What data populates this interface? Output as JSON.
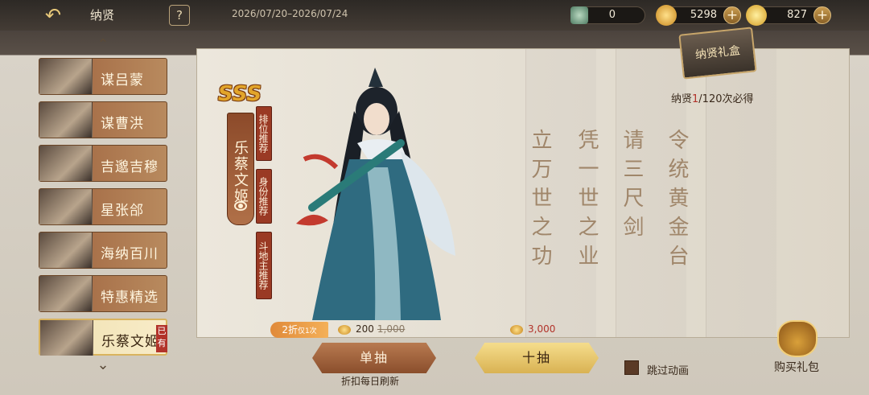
{
  "topbar": {
    "title": "纳贤",
    "help_label": "?",
    "date_range": "2026/07/20–2026/07/24",
    "resources": [
      {
        "icon": "token-icon",
        "value": "0"
      },
      {
        "icon": "gold-ingot-icon",
        "value": "5298"
      },
      {
        "icon": "treasure-ingot-icon",
        "value": "827"
      }
    ],
    "plus": "+"
  },
  "sidebar": {
    "items": [
      {
        "label": "谋吕蒙",
        "active": false
      },
      {
        "label": "谋曹洪",
        "active": false
      },
      {
        "label": "吉邈吉穆",
        "active": false
      },
      {
        "label": "星张郃",
        "active": false
      },
      {
        "label": "海纳百川",
        "active": false
      },
      {
        "label": "特惠精选",
        "active": false
      },
      {
        "label": "乐蔡文姬",
        "active": true,
        "badge": "已有"
      }
    ]
  },
  "hero": {
    "rank": "SSS",
    "name": "乐蔡文姬",
    "recommendations": [
      "排位推荐",
      "身份推荐",
      "斗地主推荐"
    ]
  },
  "poem": [
    "令统黄金台",
    "请三尺剑",
    "凭一世之业",
    "立万世之功"
  ],
  "gift_box_label": "纳贤礼盒",
  "guarantee": {
    "prefix": "纳贤",
    "current": "1",
    "suffix": "/120次必得"
  },
  "discount_tag": {
    "main": "2折",
    "sub": "仅1次"
  },
  "single": {
    "label": "单抽",
    "cost": "200",
    "old_cost": "1,000",
    "note": "折扣每日刷新"
  },
  "ten": {
    "label": "十抽",
    "cost": "3,000"
  },
  "skip_label": "跳过动画",
  "buy_label": "购买礼包"
}
